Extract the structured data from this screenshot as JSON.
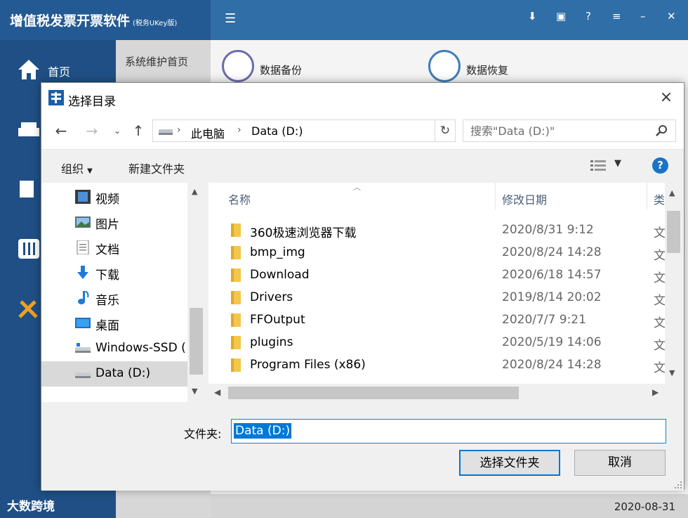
{
  "app": {
    "title": "增值税发票开票软件",
    "title_suffix": "(税务UKey版)",
    "nav_home": "首页",
    "subnav_item": "系统维护首页",
    "card_backup": "数据备份",
    "card_restore": "数据恢复",
    "brand": "大数跨境",
    "date": "2020-08-31"
  },
  "dialog": {
    "title": "选择目录",
    "close_icon": "×",
    "breadcrumbs": [
      "此电脑",
      "Data (D:)"
    ],
    "search_placeholder": "搜索\"Data (D:)\"",
    "organize": "组织",
    "new_folder": "新建文件夹",
    "help": "?",
    "tree": [
      {
        "label": "视频",
        "icon": "video-icon"
      },
      {
        "label": "图片",
        "icon": "picture-icon"
      },
      {
        "label": "文档",
        "icon": "document-icon"
      },
      {
        "label": "下载",
        "icon": "download-icon"
      },
      {
        "label": "音乐",
        "icon": "music-icon"
      },
      {
        "label": "桌面",
        "icon": "desktop-icon"
      },
      {
        "label": "Windows-SSD (",
        "icon": "drive-icon"
      },
      {
        "label": "Data (D:)",
        "icon": "drive-icon",
        "selected": true
      }
    ],
    "columns": {
      "name": "名称",
      "modified": "修改日期",
      "type": "类"
    },
    "files": [
      {
        "name": "360极速浏览器下载",
        "modified": "2020/8/31 9:12",
        "type": "文"
      },
      {
        "name": "bmp_img",
        "modified": "2020/8/24 14:28",
        "type": "文"
      },
      {
        "name": "Download",
        "modified": "2020/6/18 14:57",
        "type": "文"
      },
      {
        "name": "Drivers",
        "modified": "2019/8/14 20:02",
        "type": "文"
      },
      {
        "name": "FFOutput",
        "modified": "2020/7/7 9:21",
        "type": "文"
      },
      {
        "name": "plugins",
        "modified": "2020/5/19 14:06",
        "type": "文"
      },
      {
        "name": "Program Files (x86)",
        "modified": "2020/8/24 14:28",
        "type": "文"
      }
    ],
    "folder_label": "文件夹:",
    "folder_value": "Data (D:)",
    "select_button": "选择文件夹",
    "cancel_button": "取消"
  },
  "colors": {
    "app_header": "#2f6ea7",
    "app_sidebar": "#1f4f84",
    "accent": "#0078d7",
    "folder": "#f4c64a"
  }
}
